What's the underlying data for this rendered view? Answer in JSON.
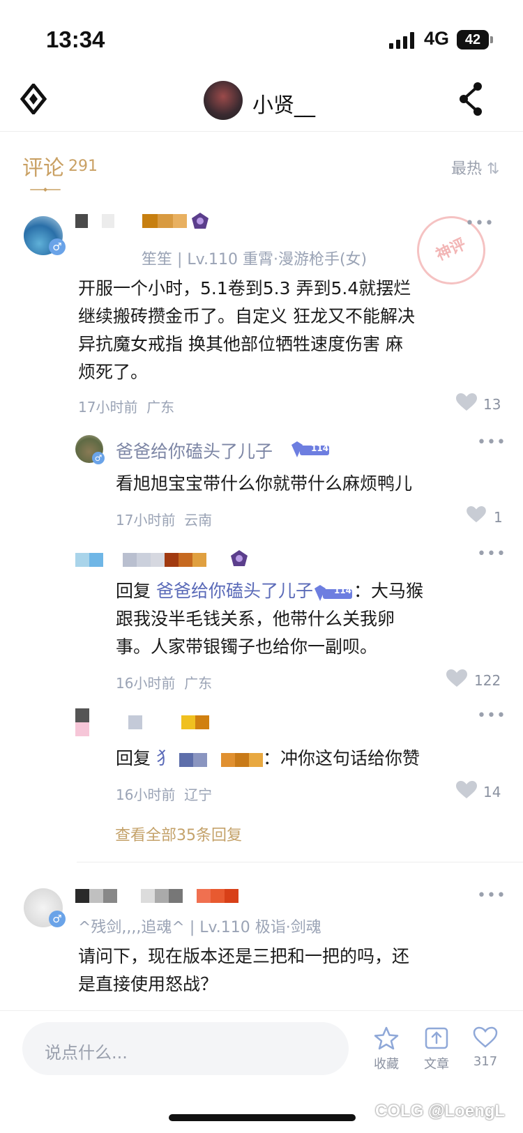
{
  "status": {
    "time": "13:34",
    "network": "4G",
    "battery": "42"
  },
  "header": {
    "title": "小贤__"
  },
  "comments": {
    "label": "评论",
    "count": "291",
    "sort": "最热"
  },
  "stamp_text": "神评",
  "comment1": {
    "meta": "笙笙 | Lv.110 重霄·漫游枪手(女)",
    "body_lines": [
      "开服一个小时，5.1卷到5.3 弄到5.4就摆烂",
      "继续搬砖攒金币了。自定义 狂龙又不能解决",
      "异抗魔女戒指 换其他部位牺牲速度伤害 麻",
      "烦死了。"
    ],
    "time": "17小时前",
    "region": "广东",
    "likes": "13",
    "replies": [
      {
        "name": "爸爸给你磕头了儿子",
        "level": "114",
        "text": "看旭旭宝宝带什么你就带什么麻烦鸭儿",
        "time": "17小时前",
        "region": "云南",
        "likes": "1"
      },
      {
        "reply_prefix": "回复",
        "reply_to": "爸爸给你磕头了儿子",
        "level": "114",
        "text_tail": "：大马猴",
        "text_lines": [
          "跟我没半毛钱关系，他带什么关我卵",
          "事。人家带银镯子也给你一副呗。"
        ],
        "time": "16小时前",
        "region": "广东",
        "likes": "122"
      },
      {
        "reply_prefix": "回复",
        "reply_fragment": "犭",
        "text_tail": "：冲你这句话给你赞",
        "time": "16小时前",
        "region": "辽宁",
        "likes": "14"
      }
    ],
    "view_all": "查看全部35条回复"
  },
  "comment2": {
    "meta": "^残剑,,,,追魂^ | Lv.110 极诣·剑魂",
    "body_lines": [
      "请问下，现在版本还是三把和一把的吗，还",
      "是直接使用怒战？"
    ]
  },
  "bottom": {
    "placeholder": "说点什么...",
    "favorite": "收藏",
    "share": "文章",
    "likes": "317"
  },
  "watermark": "COLG @LoengL",
  "colors": {
    "accent": "#c9a063",
    "name": "#7d8aa0",
    "bg": "#ffffff"
  }
}
